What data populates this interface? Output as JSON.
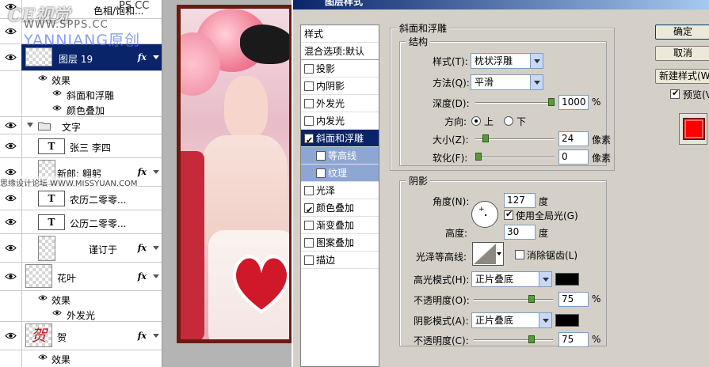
{
  "watermark": {
    "logo": "CE视觉",
    "site_a": "PS.CC",
    "site_b": "WWW.SPPS.CC",
    "site_c": "YANNIANG原创",
    "forum": "思缘设计论坛 WWW.MISSYUAN.COM"
  },
  "layers": {
    "top_partial": "色相/饱和...",
    "rows": [
      {
        "name": "图层 19",
        "fx": "fx",
        "selected": true
      },
      {
        "name": "效果"
      },
      {
        "name": "斜面和浮雕"
      },
      {
        "name": "颜色叠加"
      },
      {
        "name": "文字"
      },
      {
        "name": "张三  李四",
        "type": "T"
      },
      {
        "name": "新郎:      翱躬",
        "fx": "fx"
      },
      {
        "name": "农历二零零...",
        "type": "T"
      },
      {
        "name": "公历二零零...",
        "type": "T"
      },
      {
        "name": "谨订于",
        "fx": "fx"
      },
      {
        "name": "花叶",
        "fx": "fx"
      },
      {
        "name": "效果"
      },
      {
        "name": "外发光"
      },
      {
        "name": "贺",
        "fx": "fx"
      },
      {
        "name": "效果"
      }
    ],
    "thumb_glyph": "贺"
  },
  "dialog": {
    "title": "图层样式",
    "style_list": {
      "header": "样式",
      "blend": "混合选项:默认",
      "items": [
        {
          "label": "投影",
          "checked": false
        },
        {
          "label": "内阴影",
          "checked": false
        },
        {
          "label": "外发光",
          "checked": false
        },
        {
          "label": "内发光",
          "checked": false
        },
        {
          "label": "斜面和浮雕",
          "checked": true,
          "active": true
        },
        {
          "label": "等高线",
          "checked": false,
          "sub": true
        },
        {
          "label": "纹理",
          "checked": false,
          "sub": true
        },
        {
          "label": "光泽",
          "checked": false
        },
        {
          "label": "颜色叠加",
          "checked": true
        },
        {
          "label": "渐变叠加",
          "checked": false
        },
        {
          "label": "图案叠加",
          "checked": false
        },
        {
          "label": "描边",
          "checked": false
        }
      ]
    },
    "bevel": {
      "group_title": "斜面和浮雕",
      "structure_title": "结构",
      "style_label": "样式(T):",
      "style_value": "枕状浮雕",
      "technique_label": "方法(Q):",
      "technique_value": "平滑",
      "depth_label": "深度(D):",
      "depth_value": "1000",
      "depth_unit": "%",
      "depth_level": 1.0,
      "direction_label": "方向:",
      "dir_up": "上",
      "dir_down": "下",
      "size_label": "大小(Z):",
      "size_value": "24",
      "size_unit": "像素",
      "size_level": 0.1,
      "soften_label": "软化(F):",
      "soften_value": "0",
      "soften_unit": "像素",
      "soften_level": 0.0
    },
    "shading": {
      "title": "阴影",
      "angle_label": "角度(N):",
      "angle_value": "127",
      "angle_unit": "度",
      "global_light": "使用全局光(G)",
      "altitude_label": "高度:",
      "altitude_value": "30",
      "altitude_unit": "度",
      "gloss_label": "光泽等高线:",
      "antialias": "消除锯齿(L)",
      "highlight_label": "高光模式(H):",
      "highlight_value": "正片叠底",
      "highlight_color": "#000000",
      "opacity_label": "不透明度(O):",
      "opacity_value": "75",
      "opacity_unit": "%",
      "opacity_level": 0.75,
      "shadow_label": "阴影模式(A):",
      "shadow_value": "正片叠底",
      "shadow_color": "#000000",
      "opacity2_label": "不透明度(C):",
      "opacity2_value": "75",
      "opacity2_unit": "%",
      "opacity2_level": 0.75
    },
    "buttons": {
      "ok": "确定",
      "cancel": "取消",
      "new_style": "新建样式(W)...",
      "preview": "预览(V)"
    },
    "preview_color": "#ff0000"
  }
}
